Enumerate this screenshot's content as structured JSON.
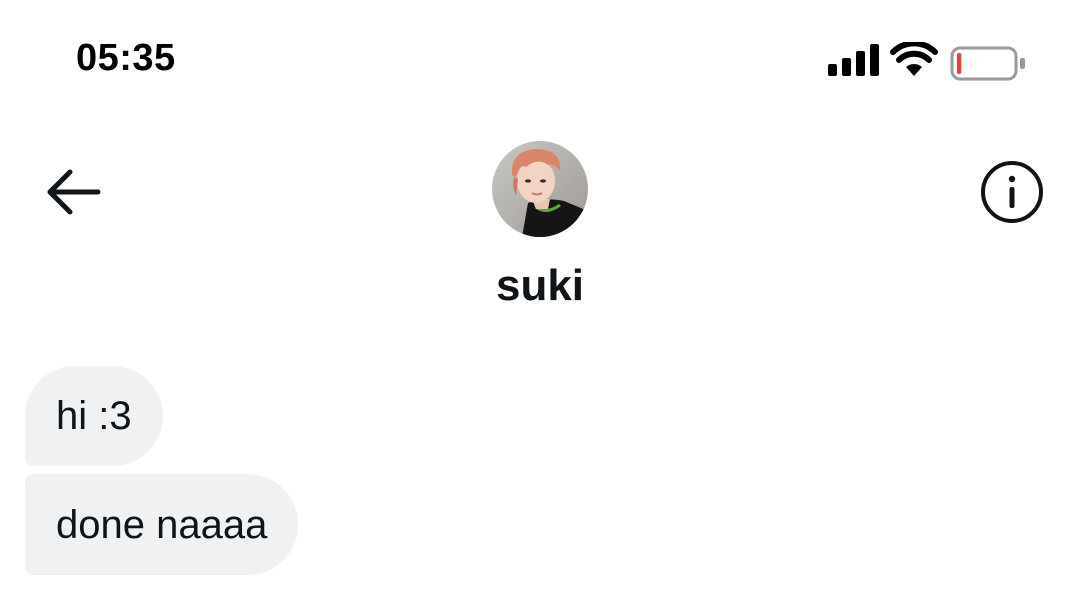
{
  "status_bar": {
    "time": "05:35",
    "icons": [
      "cellular-signal-icon",
      "wifi-icon",
      "battery-low-icon"
    ],
    "battery_fill_fraction": 0.08,
    "battery_color": "#e0443a"
  },
  "header": {
    "back_icon": "arrow-left-icon",
    "info_icon": "info-circle-icon",
    "contact_name": "suki"
  },
  "messages": [
    {
      "text": "hi :3"
    },
    {
      "text": "done naaaa"
    }
  ],
  "colors": {
    "bubble_received": "#eff1f3",
    "text": "#0f1419"
  }
}
